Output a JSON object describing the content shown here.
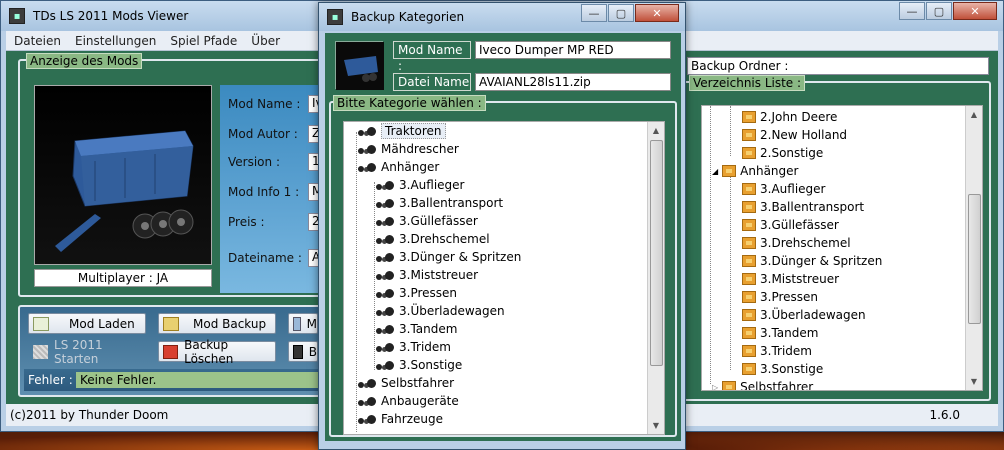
{
  "main": {
    "title": "TDs LS 2011 Mods Viewer",
    "menu": [
      "Dateien",
      "Einstellungen",
      "Spiel Pfade",
      "Über"
    ],
    "mod_group_title": "Anzeige des Mods",
    "multiplayer": "Multiplayer : JA",
    "fields": [
      {
        "label": "Mod Name :",
        "value": "Iv"
      },
      {
        "label": "Mod Autor :",
        "value": "Z"
      },
      {
        "label": "Version :",
        "value": "1"
      },
      {
        "label": "Mod Info 1 :",
        "value": "M"
      },
      {
        "label": "Preis :",
        "value": "2"
      },
      {
        "label": "Dateiname :",
        "value": "A"
      }
    ],
    "buttons": {
      "mod_laden": "Mod Laden",
      "mod_backup": "Mod Backup",
      "mod_third": "M",
      "ls_starten": "LS 2011 Starten",
      "backup_loeschen": "Backup  Löschen",
      "b_third": "B"
    },
    "fehler_label": "Fehler :",
    "fehler_value": "Keine Fehler.",
    "copyright": "(c)2011 by Thunder Doom",
    "version": "1.6.0",
    "backup_ordner": "Backup Ordner :",
    "verzeichnis_title": "Verzeichnis Liste :",
    "verzeichnis_items": [
      {
        "label": "2.John Deere",
        "level": 2
      },
      {
        "label": "2.New Holland",
        "level": 2
      },
      {
        "label": "2.Sonstige",
        "level": 2
      },
      {
        "label": "Anhänger",
        "level": 1,
        "expanded": true
      },
      {
        "label": "3.Auflieger",
        "level": 2
      },
      {
        "label": "3.Ballentransport",
        "level": 2
      },
      {
        "label": "3.Güllefässer",
        "level": 2
      },
      {
        "label": "3.Drehschemel",
        "level": 2
      },
      {
        "label": "3.Dünger & Spritzen",
        "level": 2
      },
      {
        "label": "3.Miststreuer",
        "level": 2
      },
      {
        "label": "3.Pressen",
        "level": 2
      },
      {
        "label": "3.Überladewagen",
        "level": 2
      },
      {
        "label": "3.Tandem",
        "level": 2
      },
      {
        "label": "3.Tridem",
        "level": 2
      },
      {
        "label": "3.Sonstige",
        "level": 2
      },
      {
        "label": "Selbstfahrer",
        "level": 1,
        "expanded": false
      }
    ]
  },
  "dialog": {
    "title": "Backup Kategorien",
    "mod_name_label": "Mod Name :",
    "mod_name_value": "Iveco Dumper MP RED",
    "datei_name_label": "Datei Name :",
    "datei_name_value": "AVAIANL28ls11.zip",
    "group_title": "Bitte Kategorie wählen :",
    "tree": [
      {
        "label": "Traktoren",
        "level": 1,
        "selected": true
      },
      {
        "label": "Mähdrescher",
        "level": 1
      },
      {
        "label": "Anhänger",
        "level": 1
      },
      {
        "label": "3.Auflieger",
        "level": 2
      },
      {
        "label": "3.Ballentransport",
        "level": 2
      },
      {
        "label": "3.Güllefässer",
        "level": 2
      },
      {
        "label": "3.Drehschemel",
        "level": 2
      },
      {
        "label": "3.Dünger & Spritzen",
        "level": 2
      },
      {
        "label": "3.Miststreuer",
        "level": 2
      },
      {
        "label": "3.Pressen",
        "level": 2
      },
      {
        "label": "3.Überladewagen",
        "level": 2
      },
      {
        "label": "3.Tandem",
        "level": 2
      },
      {
        "label": "3.Tridem",
        "level": 2
      },
      {
        "label": "3.Sonstige",
        "level": 2
      },
      {
        "label": "Selbstfahrer",
        "level": 1
      },
      {
        "label": "Anbaugeräte",
        "level": 1
      },
      {
        "label": "Fahrzeuge",
        "level": 1
      }
    ]
  }
}
